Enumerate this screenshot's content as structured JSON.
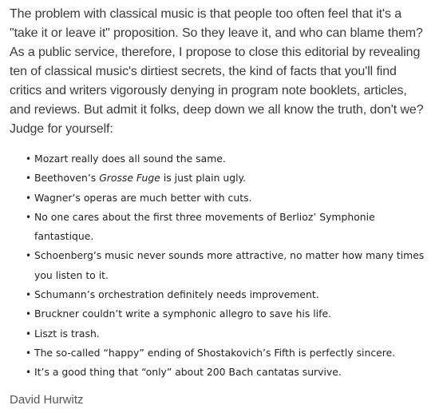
{
  "intro": "The problem with classical music is that people too often feel that it's a \"take it or leave it\" proposition. So they leave it, and who can blame them? As a public service, therefore, I propose to close this editorial by revealing ten of classical music's dirtiest secrets, the kind of facts that you'll find critics and writers vigorously denying in program note booklets, articles, and reviews. But admit it folks, deep down we all know the truth, don't we? Judge for yourself:",
  "secrets": [
    {
      "text": "Mozart really does all sound the same."
    },
    {
      "before": "Beethoven’s ",
      "emphasis": "Grosse Fuge",
      "after": " is just plain ugly."
    },
    {
      "text": "Wagner’s operas are much better with cuts."
    },
    {
      "text": "No one cares about the first three movements of Berlioz’ Symphonie fantastique."
    },
    {
      "text": "Schoenberg’s music never sounds more attractive, no matter how many times you listen to it."
    },
    {
      "text": "Schumann’s orchestration definitely needs improvement."
    },
    {
      "text": "Bruckner couldn’t write a symphonic allegro to save his life."
    },
    {
      "text": "Liszt is trash."
    },
    {
      "text": "The so-called “happy” ending of Shostakovich’s Fifth is perfectly sincere."
    },
    {
      "text": "It’s a good thing that “only” about 200 Bach cantatas survive."
    }
  ],
  "bullet_glyph": "•",
  "byline": "David Hurwitz"
}
